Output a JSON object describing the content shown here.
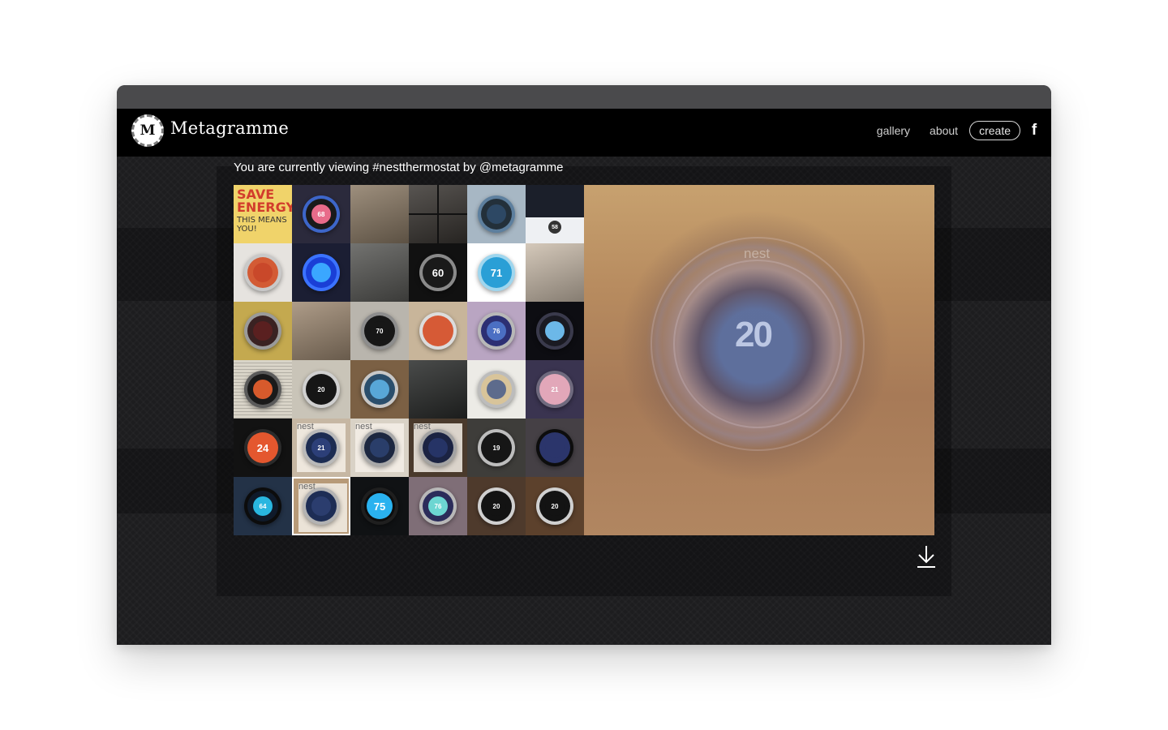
{
  "app": {
    "brand_name": "Metagramme",
    "logo_letter": "M"
  },
  "nav": {
    "gallery": "gallery",
    "about": "about",
    "create": "create",
    "facebook": "f"
  },
  "viewing_text": "You are currently viewing #nestthermostat by @metagramme",
  "colors": {
    "header_bg": "#000000",
    "chrome_bg": "#4a4a4c",
    "content_bg": "#1d1d1f",
    "nav_text": "#cfcfcf",
    "nest_orange": "#e4572e",
    "nest_blue": "#1e9bd7"
  },
  "grid": {
    "tiles": [
      {
        "kind": "poster",
        "text": "SAVE ENERGY",
        "text2": "THIS MEANS YOU!",
        "bg": "#f0d36a",
        "label": ""
      },
      {
        "kind": "dial",
        "bg": "#2b2a3c",
        "face": "#1a1a1a",
        "ring": "#3d66c9",
        "center": "#e86b8a",
        "label": "68"
      },
      {
        "kind": "photo",
        "bg": "#8d7c67",
        "label": ""
      },
      {
        "kind": "collage",
        "bg": "#3b3733",
        "label": ""
      },
      {
        "kind": "dial",
        "bg": "#a7b7c4",
        "face": "#23303a",
        "ring": "#5d7f9e",
        "center": "#2d4864",
        "label": ""
      },
      {
        "kind": "app",
        "bg": "#eef0f3",
        "label": "58"
      },
      {
        "kind": "dial",
        "bg": "#e6e3df",
        "face": "#d35b35",
        "ring": "#c9c9c9",
        "center": "#c9482a",
        "label": ""
      },
      {
        "kind": "dial",
        "bg": "#1b1e33",
        "face": "#1a3fd6",
        "ring": "#3b73ff",
        "center": "#3aa7ff",
        "label": ""
      },
      {
        "kind": "photo",
        "bg": "#5a5a57",
        "label": ""
      },
      {
        "kind": "dial",
        "bg": "#111111",
        "face": "#1a1a1a",
        "ring": "#8a8a8a",
        "center": "#1a1a1a",
        "label": "60"
      },
      {
        "kind": "dial",
        "bg": "#ffffff",
        "face": "#2a9fd6",
        "ring": "#9fd6ee",
        "center": "#2a9fd6",
        "label": "71"
      },
      {
        "kind": "photo",
        "bg": "#cdbfae",
        "label": ""
      },
      {
        "kind": "dial",
        "bg": "#c4a94f",
        "face": "#3a2222",
        "ring": "#9a9a9a",
        "center": "#5a2020",
        "label": ""
      },
      {
        "kind": "photo",
        "bg": "#a08b74",
        "label": ""
      },
      {
        "kind": "dial",
        "bg": "#b9b5ad",
        "face": "#171717",
        "ring": "#8d8d8d",
        "center": "#171717",
        "label": "70"
      },
      {
        "kind": "dial",
        "bg": "#c8b59a",
        "face": "#d65a36",
        "ring": "#dcdcdc",
        "center": "#d65a36",
        "label": ""
      },
      {
        "kind": "dial",
        "bg": "#b9a5c2",
        "face": "#2c2f73",
        "ring": "#b8b8b8",
        "center": "#4b6fc3",
        "label": "76"
      },
      {
        "kind": "dark",
        "bg": "#0d0d12",
        "face": "#1a1a22",
        "ring": "#3a3a4c",
        "center": "#6cb8e8",
        "label": ""
      },
      {
        "kind": "news",
        "bg": "#d9d4c8",
        "face": "#1a1a1a",
        "ring": "#5a5a5a",
        "center": "#d75a2c",
        "label": ""
      },
      {
        "kind": "dial",
        "bg": "#c9c4b8",
        "face": "#161616",
        "ring": "#d0d0d0",
        "center": "#161616",
        "label": "20"
      },
      {
        "kind": "dial",
        "bg": "#7b6044",
        "face": "#2a4e6c",
        "ring": "#c8c8c8",
        "center": "#58a7d8",
        "label": ""
      },
      {
        "kind": "photo",
        "bg": "#2a2c2b",
        "label": ""
      },
      {
        "kind": "dial",
        "bg": "#ecebe6",
        "face": "#d8c49a",
        "ring": "#bcbcbc",
        "center": "#5d6b8c",
        "label": ""
      },
      {
        "kind": "dial",
        "bg": "#3a3450",
        "face": "#e2a7b9",
        "ring": "#6f6a7e",
        "center": "#e2a7b9",
        "label": "21"
      },
      {
        "kind": "dial",
        "bg": "#121212",
        "face": "#e4572e",
        "ring": "#2b2b2b",
        "center": "#e4572e",
        "label": "24"
      },
      {
        "kind": "box",
        "bg": "#c6b7a3",
        "face": "#1c2c52",
        "ring": "#b9b9b9",
        "center": "#2c3f78",
        "label": "21"
      },
      {
        "kind": "box",
        "bg": "#d9d2c6",
        "face": "#1c2740",
        "ring": "#a8a8a8",
        "center": "#2a3e6a",
        "label": ""
      },
      {
        "kind": "box",
        "bg": "#4a3a2c",
        "face": "#1b2342",
        "ring": "#a3a3a3",
        "center": "#263466",
        "label": ""
      },
      {
        "kind": "dial",
        "bg": "#3e3d3a",
        "face": "#161616",
        "ring": "#bdbdbd",
        "center": "#161616",
        "label": "19"
      },
      {
        "kind": "dial",
        "bg": "#454045",
        "face": "#2b356b",
        "ring": "#0d0d0d",
        "center": "#2b356b",
        "label": ""
      },
      {
        "kind": "dial",
        "bg": "#233247",
        "face": "#0f1a2a",
        "ring": "#0c0c0c",
        "center": "#29b6e0",
        "label": "64"
      },
      {
        "kind": "box",
        "bg": "#b79a78",
        "face": "#1d2d55",
        "ring": "#b3b3b3",
        "center": "#2b3d6e",
        "label": ""
      },
      {
        "kind": "dial",
        "bg": "#101214",
        "face": "#0d0d0d",
        "ring": "#1f1f1f",
        "center": "#2ab2ef",
        "label": "75"
      },
      {
        "kind": "dial",
        "bg": "#7f6e77",
        "face": "#2b2c5a",
        "ring": "#b8b8b8",
        "center": "#6dd6d2",
        "label": "76"
      },
      {
        "kind": "dial",
        "bg": "#4e3a2c",
        "face": "#131313",
        "ring": "#d0d0d0",
        "center": "#131313",
        "label": "20"
      },
      {
        "kind": "dial",
        "bg": "#5c412c",
        "face": "#131313",
        "ring": "#d0d0d0",
        "center": "#131313",
        "label": "20"
      }
    ],
    "selected_index": 31
  },
  "composite": {
    "ghost_number": "20",
    "ghost_brand": "nest"
  },
  "icons": {
    "download": "download-icon",
    "facebook": "facebook-icon",
    "logo": "logo-icon"
  }
}
